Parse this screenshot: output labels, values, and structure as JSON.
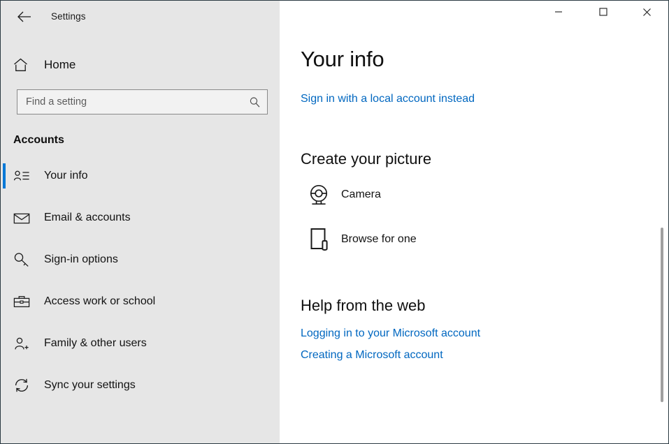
{
  "titlebar": {
    "back_icon": "back-arrow-icon",
    "title": "Settings",
    "minimize_label": "—",
    "maximize_label": "□",
    "close_label": "✕"
  },
  "sidebar": {
    "home_label": "Home",
    "home_icon": "home-icon",
    "search": {
      "placeholder": "Find a setting",
      "value": "",
      "icon": "search-icon"
    },
    "section_title": "Accounts",
    "items": [
      {
        "label": "Your info",
        "icon": "contact-card-icon",
        "selected": true
      },
      {
        "label": "Email & accounts",
        "icon": "envelope-icon",
        "selected": false
      },
      {
        "label": "Sign-in options",
        "icon": "key-icon",
        "selected": false
      },
      {
        "label": "Access work or school",
        "icon": "briefcase-icon",
        "selected": false
      },
      {
        "label": "Family & other users",
        "icon": "person-add-icon",
        "selected": false
      },
      {
        "label": "Sync your settings",
        "icon": "sync-icon",
        "selected": false
      }
    ]
  },
  "content": {
    "page_title": "Your info",
    "local_account_link": "Sign in with a local account instead",
    "create_picture": {
      "heading": "Create your picture",
      "options": [
        {
          "label": "Camera",
          "icon": "webcam-icon"
        },
        {
          "label": "Browse for one",
          "icon": "browse-file-icon"
        }
      ]
    },
    "help": {
      "heading": "Help from the web",
      "links": [
        "Logging in to your Microsoft account",
        "Creating a Microsoft account"
      ]
    }
  },
  "colors": {
    "accent": "#0078d7",
    "link": "#0067c0",
    "sidebar_bg": "#e6e6e6",
    "content_bg": "#ffffff"
  }
}
